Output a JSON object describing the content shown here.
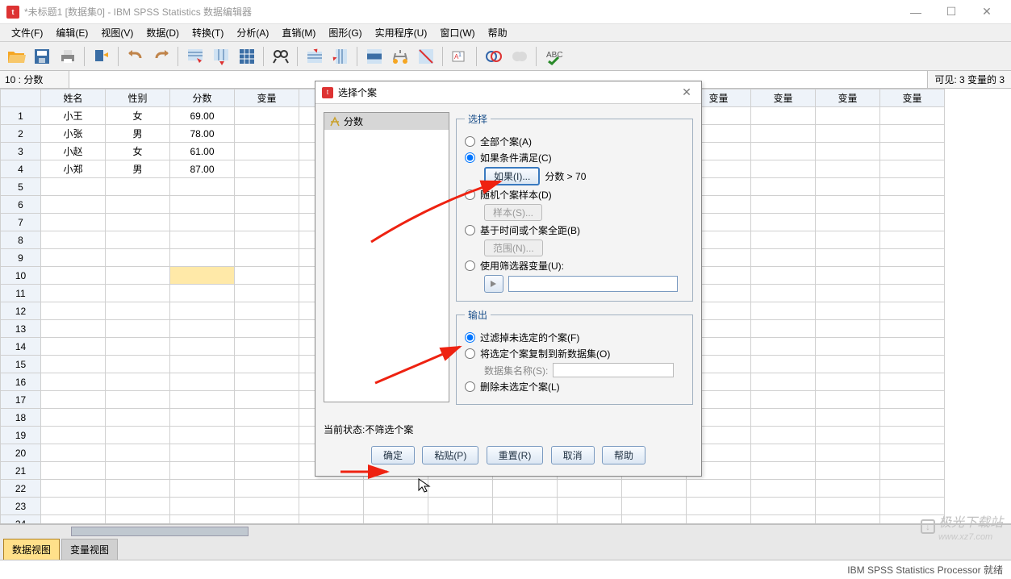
{
  "titlebar": {
    "title": "*未标题1 [数据集0] - IBM SPSS Statistics 数据编辑器"
  },
  "menus": [
    "文件(F)",
    "编辑(E)",
    "视图(V)",
    "数据(D)",
    "转换(T)",
    "分析(A)",
    "直销(M)",
    "图形(G)",
    "实用程序(U)",
    "窗口(W)",
    "帮助"
  ],
  "formula": {
    "cell": "10 : 分数",
    "visible": "可见: 3 变量的 3"
  },
  "columns": [
    "姓名",
    "性别",
    "分数",
    "变量",
    "变量",
    "变量",
    "变量",
    "变量",
    "变量",
    "变量",
    "变量",
    "变量",
    "变量",
    "变量"
  ],
  "rows": [
    {
      "n": "1",
      "c": [
        "小王",
        "女",
        "69.00"
      ]
    },
    {
      "n": "2",
      "c": [
        "小张",
        "男",
        "78.00"
      ]
    },
    {
      "n": "3",
      "c": [
        "小赵",
        "女",
        "61.00"
      ]
    },
    {
      "n": "4",
      "c": [
        "小郑",
        "男",
        "87.00"
      ]
    }
  ],
  "blankRows": 21,
  "viewTabs": {
    "data": "数据视图",
    "var": "变量视图"
  },
  "status": "IBM SPSS Statistics Processor 就绪",
  "dialog": {
    "title": "选择个案",
    "var": "分数",
    "select": {
      "legend": "选择",
      "all": "全部个案(A)",
      "ifcond": "如果条件满足(C)",
      "ifbtn": "如果(I)...",
      "ifexpr": "分数 > 70",
      "sample": "随机个案样本(D)",
      "samplebtn": "样本(S)...",
      "range": "基于时间或个案全距(B)",
      "rangebtn": "范围(N)...",
      "filter": "使用筛选器变量(U):"
    },
    "output": {
      "legend": "输出",
      "filterout": "过滤掉未选定的个案(F)",
      "copy": "将选定个案复制到新数据集(O)",
      "dslabel": "数据集名称(S):",
      "delete": "删除未选定个案(L)"
    },
    "statusline": "当前状态:不筛选个案",
    "buttons": {
      "ok": "确定",
      "paste": "粘贴(P)",
      "reset": "重置(R)",
      "cancel": "取消",
      "help": "帮助"
    }
  },
  "watermark": {
    "name": "极光下载站",
    "url": "www.xz7.com"
  }
}
